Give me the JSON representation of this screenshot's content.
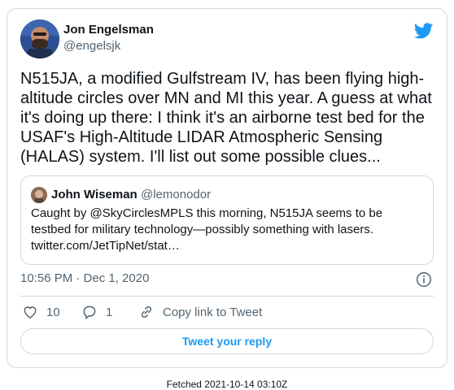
{
  "tweet": {
    "author_name": "Jon Engelsman",
    "author_handle": "@engelsjk",
    "text": "N515JA, a modified Gulfstream IV, has been flying high-altitude circles over MN and MI this year. A guess at what it's doing up there: I think it's an airborne test bed for the USAF's High-Altitude LIDAR Atmospheric Sensing (HALAS) system. I'll list out some possible clues...",
    "timestamp": "10:56 PM · Dec 1, 2020",
    "like_count": "10",
    "reply_count": "1",
    "copy_link_label": "Copy link to Tweet",
    "reply_button_label": "Tweet your reply"
  },
  "quoted_tweet": {
    "author_name": "John Wiseman",
    "author_handle": "@lemonodor",
    "text": "Caught by @SkyCirclesMPLS this morning, N515JA seems to be testbed for military technology—possibly something with lasers.",
    "link": "twitter.com/JetTipNet/stat…"
  },
  "footer": {
    "fetched": "Fetched 2021-10-14 03:10Z"
  },
  "colors": {
    "accent": "#1d9bf0",
    "muted_text": "#536471",
    "border": "#cfd9de"
  },
  "icons": [
    "twitter-bird-icon",
    "info-icon",
    "heart-icon",
    "reply-bubble-icon",
    "link-icon"
  ]
}
